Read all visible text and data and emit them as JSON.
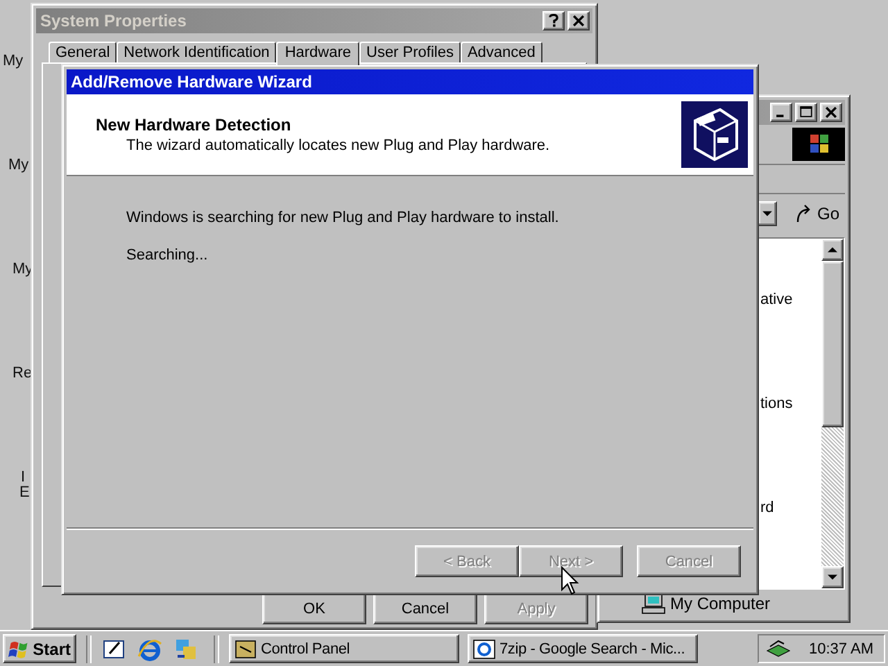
{
  "desktop": {
    "icon_labels": [
      "My",
      "My",
      "My",
      "Re",
      "I",
      "E"
    ]
  },
  "system_properties": {
    "title": "System Properties",
    "active": false,
    "tabs": [
      {
        "label": "General",
        "selected": false
      },
      {
        "label": "Network Identification",
        "selected": false
      },
      {
        "label": "Hardware",
        "selected": true
      },
      {
        "label": "User Profiles",
        "selected": false
      },
      {
        "label": "Advanced",
        "selected": false
      }
    ],
    "buttons": [
      {
        "label": "OK",
        "disabled": false
      },
      {
        "label": "Cancel",
        "disabled": false
      },
      {
        "label": "Apply",
        "disabled": true
      }
    ]
  },
  "browser": {
    "go": "Go",
    "list_items": [
      "ative",
      "tions",
      "rd"
    ],
    "status": "My Computer"
  },
  "wizard": {
    "title": "Add/Remove Hardware Wizard",
    "active": true,
    "heading": "New Hardware Detection",
    "subtitle": "The wizard automatically locates new Plug and Play hardware.",
    "message": "Windows is searching for new Plug and Play hardware to install.",
    "status": "Searching...",
    "buttons": [
      {
        "label": "< Back",
        "disabled": true
      },
      {
        "label": "Next >",
        "disabled": true
      },
      {
        "label": "Cancel",
        "disabled": true
      }
    ]
  },
  "taskbar": {
    "start": "Start",
    "tasks": [
      {
        "label": "Control Panel",
        "selected": false
      },
      {
        "label": "7zip - Google Search - Mic...",
        "selected": false
      }
    ],
    "clock": "10:37 AM"
  }
}
